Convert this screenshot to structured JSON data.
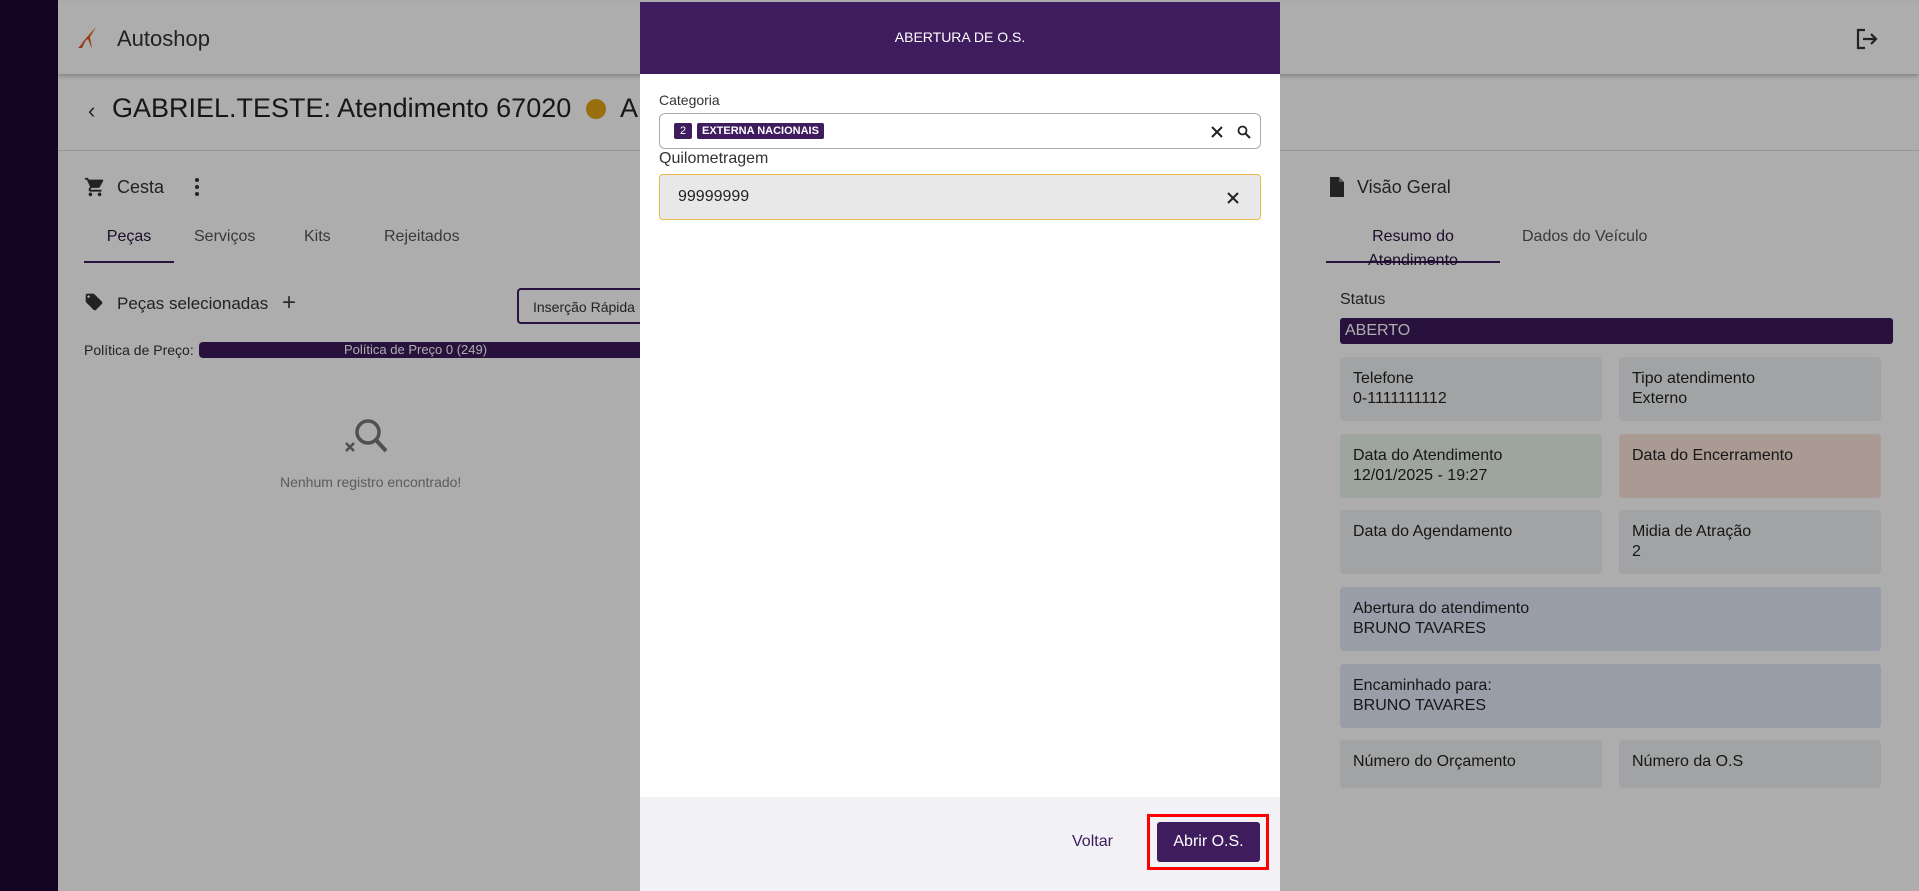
{
  "app": {
    "name": "Autoshop"
  },
  "page": {
    "title": "GABRIEL.TESTE: Atendimento 67020",
    "title_suffix": "AI"
  },
  "cesta": {
    "label": "Cesta",
    "tabs": [
      "Peças",
      "Serviços",
      "Kits",
      "Rejeitados"
    ],
    "active_tab": "Peças",
    "selected_label": "Peças selecionadas",
    "quick_insert_label": "Inserção Rápida",
    "pricing_label": "Política de Preço:",
    "pricing_value": "Política de Preço 0 (249)",
    "empty_text": "Nenhum registro encontrado!"
  },
  "overview": {
    "label": "Visão Geral",
    "tabs": [
      "Resumo do Atendimento",
      "Dados do Veículo"
    ],
    "active_tab": "Resumo do Atendimento",
    "status_label": "Status",
    "status_value": "ABERTO",
    "cards": [
      {
        "label": "Telefone",
        "value": "0-1111111112"
      },
      {
        "label": "Tipo atendimento",
        "value": "Externo"
      },
      {
        "label": "Data do Atendimento",
        "value": "12/01/2025 - 19:27"
      },
      {
        "label": "Data do Encerramento",
        "value": ""
      },
      {
        "label": "Data do Agendamento",
        "value": ""
      },
      {
        "label": "Midia de Atração",
        "value": "2"
      },
      {
        "label": "Abertura do atendimento",
        "value": "BRUNO TAVARES"
      },
      {
        "label": "Encaminhado para:",
        "value": "BRUNO TAVARES"
      },
      {
        "label": "Número do Orçamento",
        "value": ""
      },
      {
        "label": "Número da O.S",
        "value": ""
      }
    ]
  },
  "modal": {
    "title": "ABERTURA DE O.S.",
    "category_label": "Categoria",
    "category_chip_num": "2",
    "category_chip_text": "EXTERNA NACIONAIS",
    "km_label": "Quilometragem",
    "km_value": "99999999",
    "back_label": "Voltar",
    "submit_label": "Abrir O.S."
  },
  "colors": {
    "brand_purple": "#3e1c5e",
    "status_dot": "#e2a416",
    "highlight": "#ff0000"
  }
}
